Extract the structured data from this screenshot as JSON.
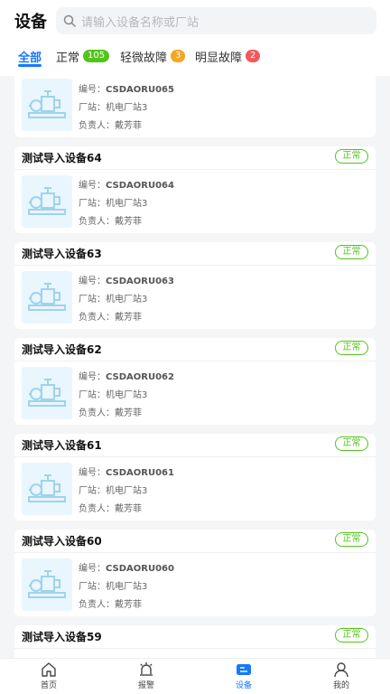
{
  "header": {
    "title": "设备",
    "search_placeholder": "请输入设备名称或厂站"
  },
  "tabs": [
    {
      "label": "全部",
      "active": true
    },
    {
      "label": "正常",
      "count": "105",
      "color": "#52c41a"
    },
    {
      "label": "轻微故障",
      "count": "3",
      "color": "#f5a623"
    },
    {
      "label": "明显故障",
      "count": "2",
      "color": "#f05a5a"
    }
  ],
  "devices": [
    {
      "name": "",
      "code_label": "编号：",
      "code": "CSDAORU065",
      "station_label": "厂站：",
      "station": "机电厂站3",
      "owner_label": "负责人：",
      "owner": "戴芳菲",
      "status": ""
    },
    {
      "name": "测试导入设备64",
      "code_label": "编号：",
      "code": "CSDAORU064",
      "station_label": "厂站：",
      "station": "机电厂站3",
      "owner_label": "负责人：",
      "owner": "戴芳菲",
      "status": "正常"
    },
    {
      "name": "测试导入设备63",
      "code_label": "编号：",
      "code": "CSDAORU063",
      "station_label": "厂站：",
      "station": "机电厂站3",
      "owner_label": "负责人：",
      "owner": "戴芳菲",
      "status": "正常"
    },
    {
      "name": "测试导入设备62",
      "code_label": "编号：",
      "code": "CSDAORU062",
      "station_label": "厂站：",
      "station": "机电厂站3",
      "owner_label": "负责人：",
      "owner": "戴芳菲",
      "status": "正常"
    },
    {
      "name": "测试导入设备61",
      "code_label": "编号：",
      "code": "CSDAORU061",
      "station_label": "厂站：",
      "station": "机电厂站3",
      "owner_label": "负责人：",
      "owner": "戴芳菲",
      "status": "正常"
    },
    {
      "name": "测试导入设备60",
      "code_label": "编号：",
      "code": "CSDAORU060",
      "station_label": "厂站：",
      "station": "机电厂站3",
      "owner_label": "负责人：",
      "owner": "戴芳菲",
      "status": "正常"
    },
    {
      "name": "测试导入设备59",
      "status": "正常"
    }
  ],
  "nav": [
    {
      "label": "首页",
      "icon": "home-icon"
    },
    {
      "label": "报警",
      "icon": "alarm-icon"
    },
    {
      "label": "设备",
      "icon": "device-icon",
      "active": true
    },
    {
      "label": "我的",
      "icon": "user-icon"
    }
  ],
  "colors": {
    "accent": "#1677ff",
    "normal": "#52c41a",
    "thumb_bg": "#e9f6fd"
  }
}
